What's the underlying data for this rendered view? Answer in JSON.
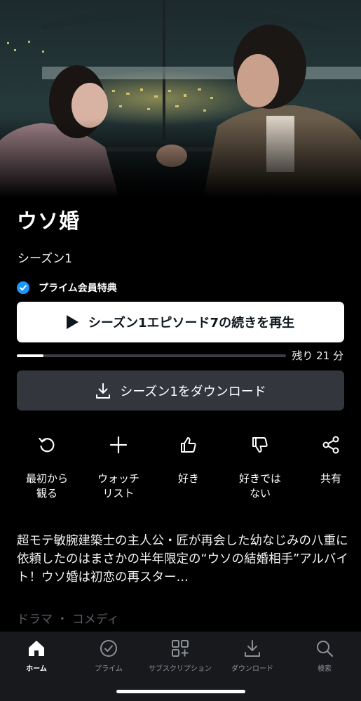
{
  "show": {
    "title": "ウソ婚",
    "season": "シーズン1",
    "prime_badge": "プライム会員特典",
    "play_label": "シーズン1エピソード7の続きを再生",
    "progress_fraction": 0.1,
    "remaining": "残り 21 分",
    "download_label": "シーズン1をダウンロード",
    "synopsis": "超モテ敏腕建築士の主人公・匠が再会した幼なじみの八重に依頼したのはまさかの半年限定の“ウソの結婚相手”アルバイト！ウソ婚は初恋の再スター…",
    "genres": "ドラマ ・ コメディ"
  },
  "actions": [
    {
      "icon": "restart-icon",
      "label": "最初から\n観る"
    },
    {
      "icon": "plus-icon",
      "label": "ウォッチ\nリスト"
    },
    {
      "icon": "thumbs-up-icon",
      "label": "好き"
    },
    {
      "icon": "thumbs-down-icon",
      "label": "好きでは\nない"
    },
    {
      "icon": "share-icon",
      "label": "共有"
    }
  ],
  "tabs": [
    {
      "icon": "home-icon",
      "label": "ホーム",
      "active": true
    },
    {
      "icon": "prime-check-icon",
      "label": "プライム",
      "active": false
    },
    {
      "icon": "subscriptions-icon",
      "label": "サブスクリプション",
      "active": false
    },
    {
      "icon": "download-icon",
      "label": "ダウンロード",
      "active": false
    },
    {
      "icon": "search-icon",
      "label": "検索",
      "active": false
    }
  ],
  "colors": {
    "background": "#000000",
    "accent_blue": "#1a98ff",
    "button_secondary": "#33373d",
    "tabbar": "#17191c"
  }
}
